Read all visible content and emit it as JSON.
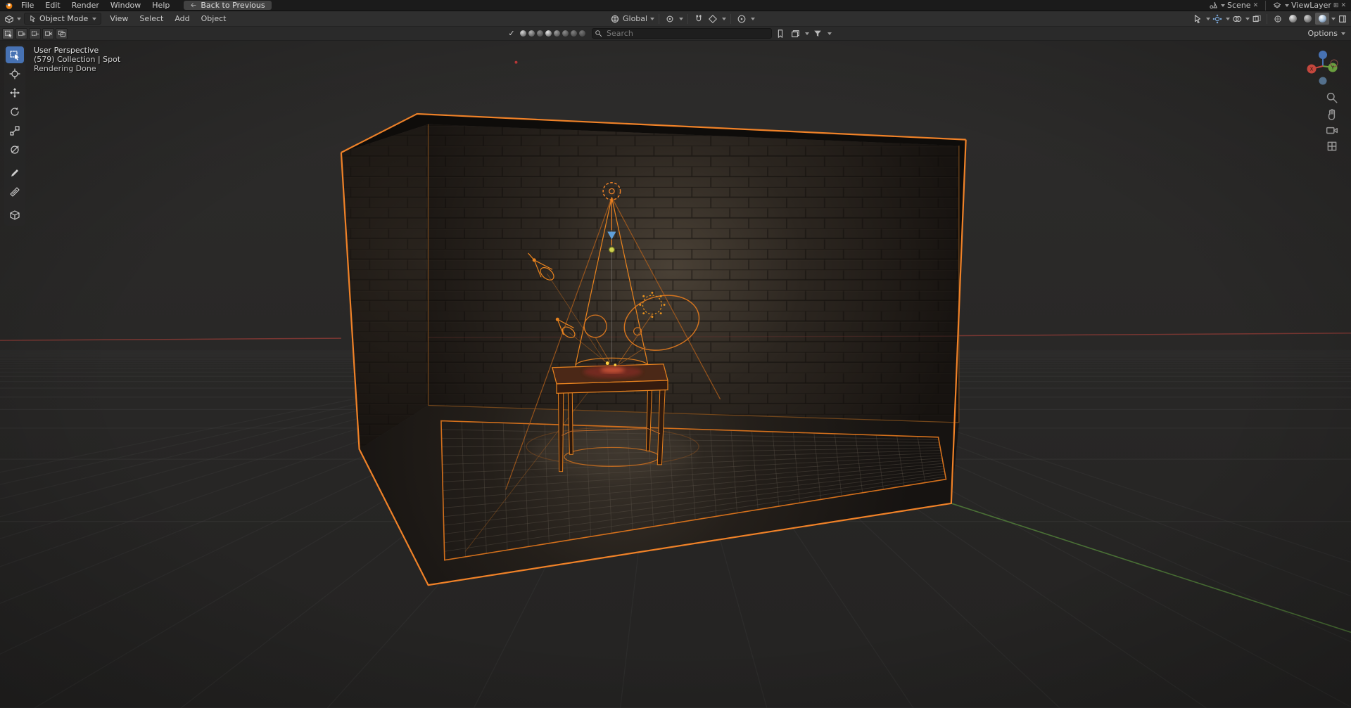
{
  "topbar": {
    "menus": [
      {
        "label": "File"
      },
      {
        "label": "Edit"
      },
      {
        "label": "Render"
      },
      {
        "label": "Window"
      },
      {
        "label": "Help"
      }
    ],
    "back_button_label": "Back to Previous",
    "scene": {
      "label": "Scene"
    },
    "view_layer": {
      "label": "ViewLayer"
    }
  },
  "viewport_header": {
    "mode_selector": "Object Mode",
    "menus": [
      {
        "label": "View"
      },
      {
        "label": "Select"
      },
      {
        "label": "Add"
      },
      {
        "label": "Object"
      }
    ],
    "transform_orientation": "Global"
  },
  "tool_settings": {
    "search": {
      "placeholder": "Search"
    },
    "options_label": "Options"
  },
  "viewport": {
    "overlay": {
      "line1": "User Perspective",
      "line2": "(579) Collection | Spot",
      "line3": "Rendering Done"
    },
    "gizmo_axes": {
      "x": "X",
      "y": "Y"
    }
  },
  "icons": {
    "close": "✕",
    "check": "✓",
    "new": "⊞"
  },
  "colors": {
    "selection_outline": "#f08228",
    "active_tool_blue": "#4772b3",
    "axis_x_red": "#8a3a35",
    "axis_y_green": "#4f7a38"
  }
}
